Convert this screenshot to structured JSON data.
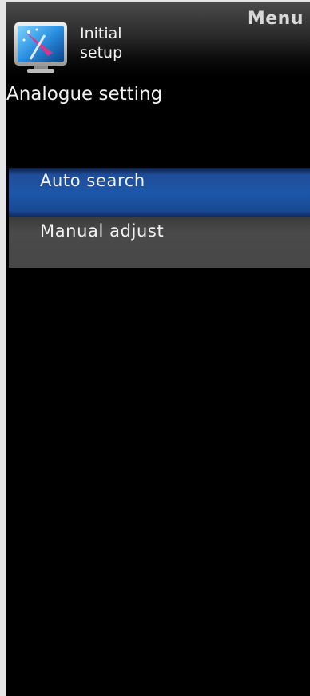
{
  "header": {
    "menu_label": "Menu",
    "category_icon": "tv-screen-icon",
    "category_line1": "Initial",
    "category_line2": "setup"
  },
  "section": {
    "title": "Analogue setting"
  },
  "items": [
    {
      "label": "Auto search",
      "selected": true
    },
    {
      "label": "Manual adjust",
      "selected": false
    }
  ],
  "colors": {
    "background": "#000000",
    "selected_item": "#1d57a8",
    "normal_item": "#474747",
    "text": "#f2f2f2"
  }
}
